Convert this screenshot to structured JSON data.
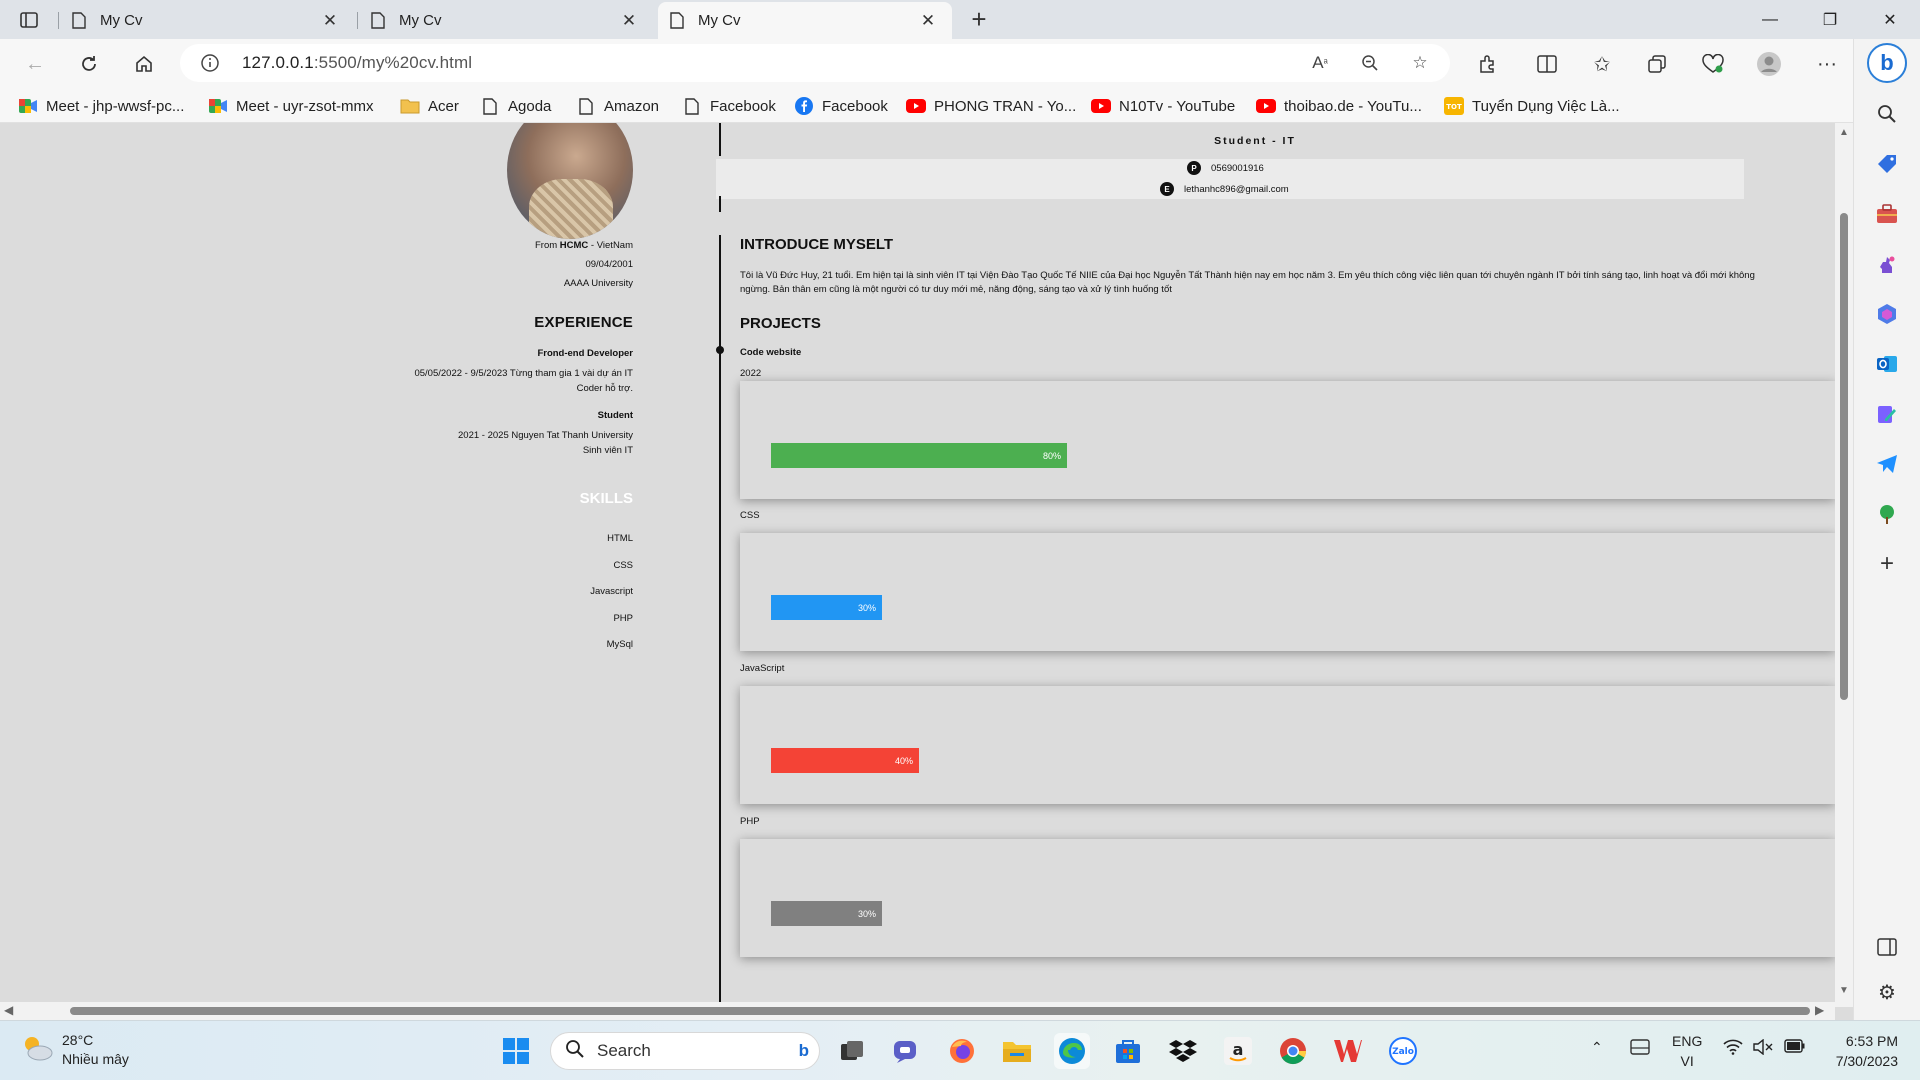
{
  "browser": {
    "tabs": [
      {
        "label": "My Cv",
        "active": false
      },
      {
        "label": "My Cv",
        "active": false
      },
      {
        "label": "My Cv",
        "active": true
      }
    ],
    "url_host": "127.0.0.1",
    "url_rest": ":5500/my%20cv.html",
    "bookmarks": [
      {
        "label": "Meet - jhp-wwsf-pc...",
        "icon": "meet-icon"
      },
      {
        "label": "Meet - uyr-zsot-mmx",
        "icon": "meet-icon"
      },
      {
        "label": "Acer",
        "icon": "folder-icon"
      },
      {
        "label": "Agoda",
        "icon": "page-icon"
      },
      {
        "label": "Amazon",
        "icon": "page-icon"
      },
      {
        "label": "Facebook",
        "icon": "page-icon"
      },
      {
        "label": "Facebook",
        "icon": "facebook-icon"
      },
      {
        "label": "PHONG TRAN - Yo...",
        "icon": "youtube-icon"
      },
      {
        "label": "N10Tv - YouTube",
        "icon": "youtube-icon"
      },
      {
        "label": "thoibao.de - YouTu...",
        "icon": "youtube-icon"
      },
      {
        "label": "Tuyển Dụng Việc Là...",
        "icon": "topcv-icon"
      }
    ]
  },
  "cv": {
    "role": "Student - IT",
    "phone_icon": "P",
    "phone": "0569001916",
    "email_icon": "E",
    "email": "lethanhc896@gmail.com",
    "from_prefix": "From ",
    "from_city": "HCMC",
    "from_suffix": " - VietNam",
    "dob": "09/04/2001",
    "university": "AAAA University",
    "experience_title": "EXPERIENCE",
    "experience": [
      {
        "title": "Frond-end Developer",
        "line1": "05/05/2022 - 9/5/2023 Từng tham gia 1 vài dự án IT",
        "line2": "Coder hỗ trợ."
      },
      {
        "title": "Student",
        "line1": "2021 - 2025 Nguyen Tat Thanh University",
        "line2": "Sinh viên IT"
      }
    ],
    "skills_title": "SKILLS",
    "skills_list": [
      "HTML",
      "CSS",
      "Javascript",
      "PHP",
      "MySql"
    ],
    "intro_title": "INTRODUCE MYSELT",
    "intro_text": "Tôi là Vũ Đức Huy, 21 tuổi. Em hiện tại là sinh viên IT tại Viện Đào Tạo Quốc Tế NIIE của Đại học Nguyễn Tất Thành hiện nay em học năm 3. Em yêu thích công việc liên quan tới chuyên ngành IT bởi tính sáng tạo, linh hoạt và đổi mới không ngừng. Bản thân em cũng là một người có tư duy mới mẻ, năng động, sáng tạo và xử lý tình huống tốt",
    "projects_title": "PROJECTS",
    "project_name": "Code website",
    "project_year": "2022",
    "bars": [
      {
        "label": "",
        "percent": 80,
        "text": "80%",
        "color": "#4caf50"
      },
      {
        "label": "CSS",
        "percent": 30,
        "text": "30%",
        "color": "#2196f3"
      },
      {
        "label": "JavaScript",
        "percent": 40,
        "text": "40%",
        "color": "#f44336"
      },
      {
        "label": "PHP",
        "percent": 30,
        "text": "30%",
        "color": "#808080"
      }
    ]
  },
  "taskbar": {
    "temperature": "28°C",
    "weather": "Nhiều mây",
    "search_label": "Search",
    "lang_top": "ENG",
    "lang_bottom": "VI",
    "time": "6:53 PM",
    "date": "7/30/2023"
  }
}
